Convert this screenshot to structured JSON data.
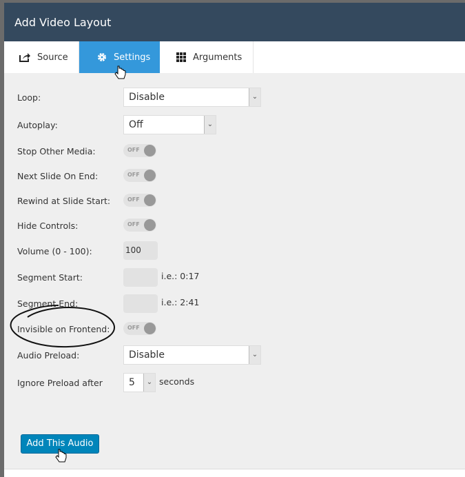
{
  "title": "Add Video Layout",
  "tabs": [
    {
      "label": "Source",
      "icon": "share-icon"
    },
    {
      "label": "Settings",
      "icon": "gear-icon",
      "active": true
    },
    {
      "label": "Arguments",
      "icon": "grid-icon"
    }
  ],
  "fields": {
    "loop": {
      "label": "Loop:",
      "value": "Disable"
    },
    "autoplay": {
      "label": "Autoplay:",
      "value": "Off"
    },
    "stop_other": {
      "label": "Stop Other Media:",
      "state": "OFF"
    },
    "next_slide": {
      "label": "Next Slide On End:",
      "state": "OFF"
    },
    "rewind": {
      "label": "Rewind at Slide Start:",
      "state": "OFF"
    },
    "hide_controls": {
      "label": "Hide Controls:",
      "state": "OFF"
    },
    "volume": {
      "label": "Volume (0 - 100):",
      "value": "100"
    },
    "segment_start": {
      "label": "Segment Start:",
      "value": "",
      "hint": "i.e.: 0:17"
    },
    "segment_end": {
      "label": "Segment End:",
      "value": "",
      "hint": "i.e.: 2:41"
    },
    "invisible": {
      "label": "Invisible on Frontend:",
      "state": "OFF"
    },
    "audio_preload": {
      "label": "Audio Preload:",
      "value": "Disable"
    },
    "ignore_preload": {
      "label": "Ignore Preload after",
      "value": "5",
      "unit": "seconds"
    }
  },
  "submit_label": "Add This Audio",
  "colors": {
    "header": "#34495e",
    "active_tab": "#3498db",
    "button": "#0085ba"
  }
}
